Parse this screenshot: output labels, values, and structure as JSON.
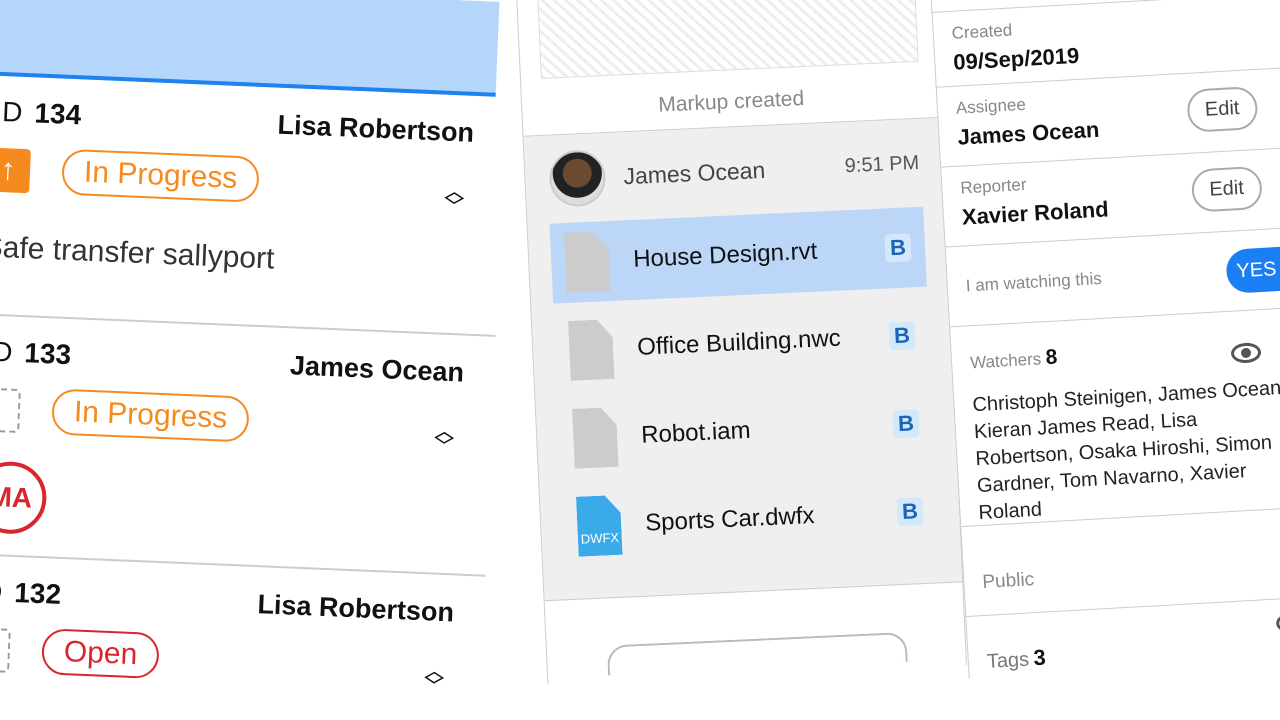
{
  "issues": [
    {
      "id_label": "ID",
      "id": "134",
      "owner": "Lisa Robertson",
      "status": "In Progress",
      "priority": "up",
      "description": "Safe transfer sallyport"
    },
    {
      "id_label": "ID",
      "id": "133",
      "owner": "James Ocean",
      "status": "In Progress",
      "priority": "none",
      "avatar": "MA"
    },
    {
      "id_label": "ID",
      "id": "132",
      "owner": "Lisa Robertson",
      "status": "Open",
      "priority": "none"
    }
  ],
  "markup": {
    "caption": "Markup created",
    "author": "James Ocean",
    "time": "9:51 PM",
    "files": [
      {
        "name": "House Design.rvt",
        "badge": "B",
        "selected": true
      },
      {
        "name": "Office Building.nwc",
        "badge": "B"
      },
      {
        "name": "Robot.iam",
        "badge": "B"
      },
      {
        "name": "Sports Car.dwfx",
        "badge": "B",
        "icon_label": "DWFX"
      }
    ]
  },
  "details": {
    "created_label": "Created",
    "created": "09/Sep/2019",
    "assignee_label": "Assignee",
    "assignee": "James Ocean",
    "reporter_label": "Reporter",
    "reporter": "Xavier Roland",
    "edit": "Edit",
    "watching_label": "I am watching this",
    "watching_value": "YES",
    "watchers_label": "Watchers",
    "watchers_count": "8",
    "watchers": "Christoph Steinigen, James Ocean, Kieran James Read, Lisa Robertson, Osaka Hiroshi, Simon Gardner, Tom Navarno, Xavier Roland",
    "public_label": "Public",
    "tags_label": "Tags",
    "tags_count": "3"
  },
  "colors": {
    "accent": "#1a7ef5",
    "orange": "#f58b1f",
    "red": "#d9262c"
  }
}
